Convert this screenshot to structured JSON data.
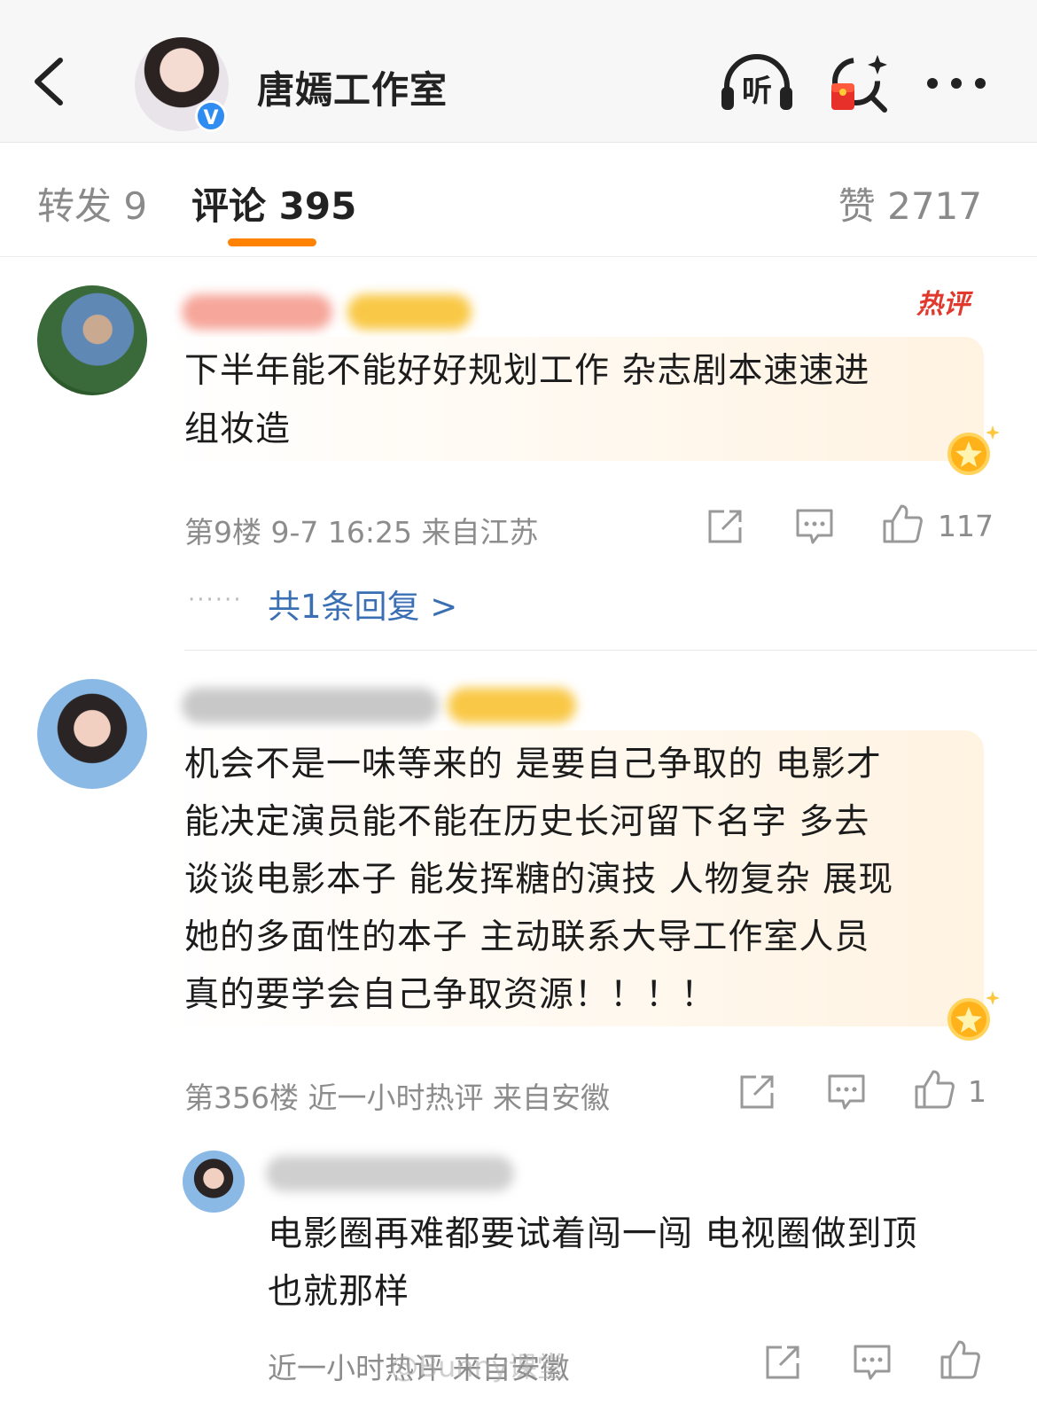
{
  "header": {
    "back_icon": "chevron-left-icon",
    "title": "唐嫣工作室",
    "verified_badge": "V",
    "listen_label": "听",
    "actions": [
      "headphone-listen-icon",
      "red-packet-search-icon",
      "more-icon"
    ]
  },
  "tabs": [
    {
      "label": "转发 9"
    },
    {
      "label": "评论 395"
    },
    {
      "label": "赞 2717"
    }
  ],
  "comments": [
    {
      "hot_badge": "热评",
      "text_lines": [
        "下半年能不能好好规划工作 杂志剧本速速进",
        "组妆造"
      ],
      "meta": "第9楼 9-7 16:25 来自江苏",
      "likes": "117",
      "replies_link": "共1条回复 >",
      "dots": "······"
    },
    {
      "text_lines": [
        "机会不是一味等来的 是要自己争取的 电影才",
        "能决定演员能不能在历史长河留下名字 多去",
        "谈谈电影本子 能发挥糖的演技 人物复杂 展现",
        "她的多面性的本子 主动联系大导工作室人员",
        "真的要学会自己争取资源！！！！"
      ],
      "meta": "第356楼 近一小时热评 来自安徽",
      "likes": "1",
      "reply": {
        "text_lines": [
          "电影圈再难都要试着闯一闯 电视圈做到顶",
          "也就那样"
        ],
        "meta": "近一小时热评 来自安徽"
      }
    }
  ],
  "watermark": "@Bunny课堂",
  "colors": {
    "accent_orange": "#ff8200",
    "link_blue": "#3a6fb3",
    "hot_red": "#e03a2f",
    "verified_blue": "#2f8cf0"
  }
}
